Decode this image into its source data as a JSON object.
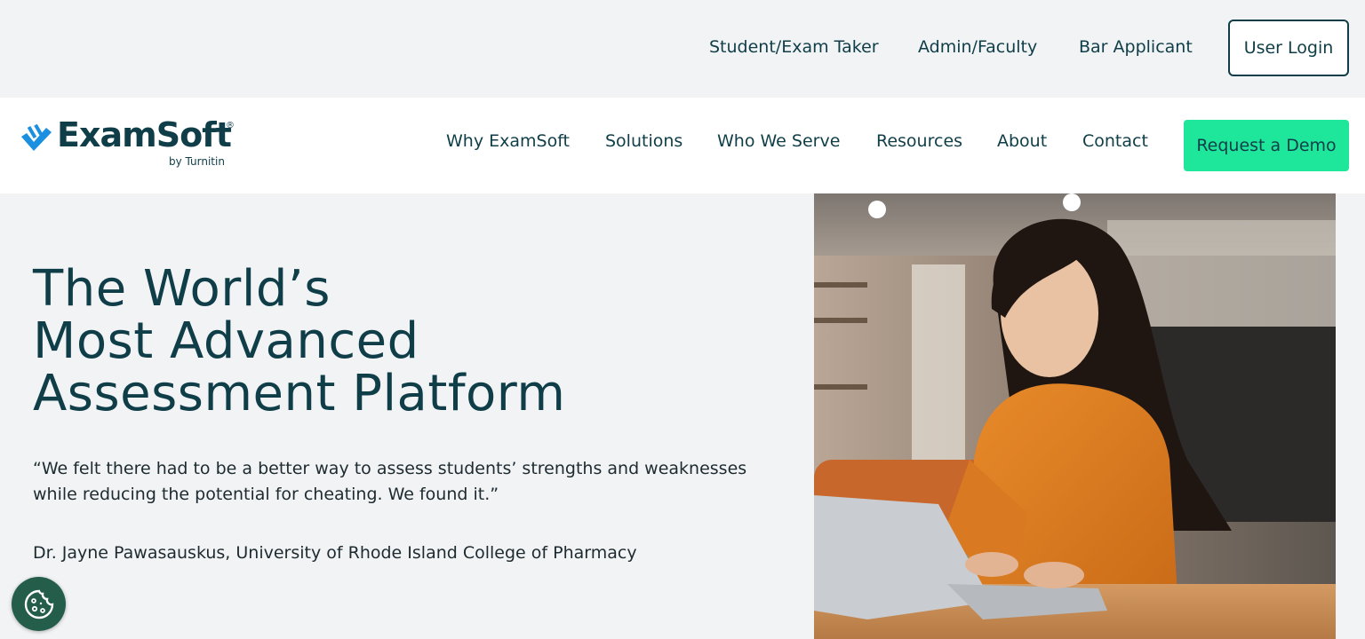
{
  "utility_nav": {
    "student_link": "Student/Exam Taker",
    "admin_link": "Admin/Faculty",
    "bar_link": "Bar Applicant",
    "login_button": "User Login"
  },
  "logo": {
    "name": "ExamSoft",
    "registered_mark": "®",
    "tagline": "by Turnitin"
  },
  "main_nav": {
    "items": [
      "Why ExamSoft",
      "Solutions",
      "Who We Serve",
      "Resources",
      "About",
      "Contact"
    ],
    "cta": "Request a Demo"
  },
  "hero": {
    "title_lines": [
      "The World’s",
      "Most Advanced",
      "Assessment Platform"
    ],
    "quote": "“We felt there had to be a better way to assess students’ strengths and weaknesses while reducing the potential for cheating. We found it.”",
    "attribution": "Dr. Jayne Pawasauskus, University of Rhode Island College of Pharmacy"
  },
  "colors": {
    "brand_dark": "#0f3e48",
    "brand_blue": "#1b8fe0",
    "cta_green": "#1ee69b",
    "page_bg": "#f2f3f5",
    "cookie_green": "#245e4a"
  },
  "icons": {
    "logo_mark": "checkmark-bars-icon",
    "cookie": "cookie-icon"
  }
}
